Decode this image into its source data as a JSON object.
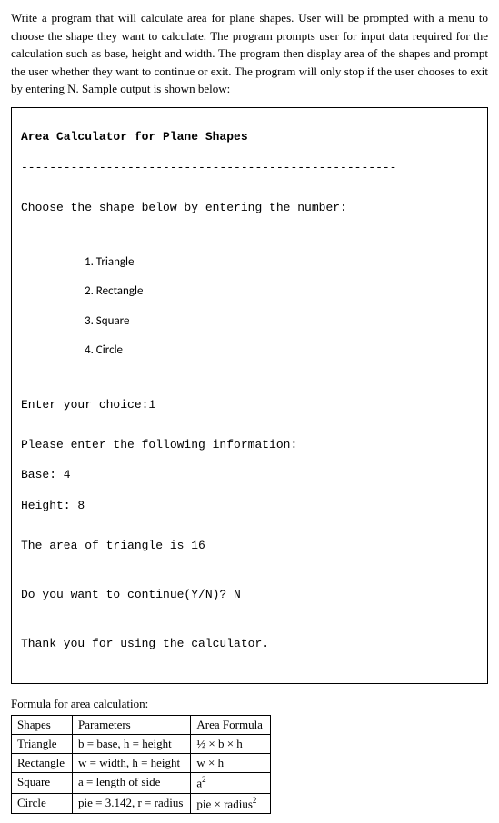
{
  "instructions": "Write a program that will calculate area for plane shapes. User will be prompted with a menu to choose the shape they want to calculate. The program prompts user for input data required for the calculation such as base, height and width. The program then display area of the shapes and prompt the user whether they want to continue or exit. The program will only stop if the user chooses to exit by entering N. Sample output is shown below:",
  "output": {
    "title": "Area Calculator for Plane Shapes",
    "separator": "-----------------------------------------------------",
    "prompt": "Choose the shape below by entering the number:",
    "menu": {
      "item1": "1. Triangle",
      "item2": "2. Rectangle",
      "item3": "3. Square",
      "item4": "4. Circle"
    },
    "choice_line": "Enter your choice:1",
    "info_prompt": "Please enter the following information:",
    "base_line": "Base: 4",
    "height_line": "Height: 8",
    "result_line": "The area of triangle is 16",
    "continue_line": "Do you want to continue(Y/N)? N",
    "thanks_line": "Thank you for using the calculator."
  },
  "formula": {
    "label": "Formula for area calculation:",
    "headers": {
      "shapes": "Shapes",
      "params": "Parameters",
      "area": "Area Formula"
    },
    "rows": {
      "triangle": {
        "shape": "Triangle",
        "params": "b = base, h = height",
        "area": "½ × b × h"
      },
      "rectangle": {
        "shape": "Rectangle",
        "params": "w = width, h = height",
        "area": "w × h"
      },
      "square": {
        "shape": "Square",
        "params": "a = length of side",
        "area_base": "a",
        "area_exp": "2"
      },
      "circle": {
        "shape": "Circle",
        "params": "pie = 3.142, r = radius",
        "area_base": "pie × radius",
        "area_exp": "2"
      }
    }
  }
}
